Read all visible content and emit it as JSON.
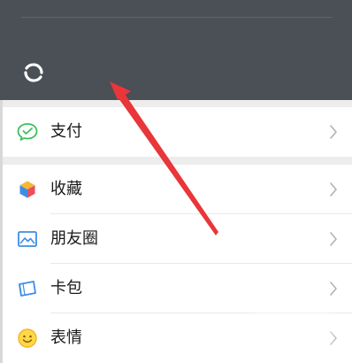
{
  "header": {
    "sync_icon": "sync-icon"
  },
  "pay": {
    "label": "支付",
    "icon": "wallet-icon"
  },
  "menu": {
    "items": [
      {
        "label": "收藏",
        "icon": "favorites-cube-icon"
      },
      {
        "label": "朋友圈",
        "icon": "moments-picture-icon"
      },
      {
        "label": "卡包",
        "icon": "card-wallet-icon"
      },
      {
        "label": "表情",
        "icon": "sticker-smiley-icon"
      }
    ]
  },
  "colors": {
    "header_bg": "#4b4f56",
    "pay_green": "#3fbf5f",
    "arrow_red": "#e8363a"
  }
}
